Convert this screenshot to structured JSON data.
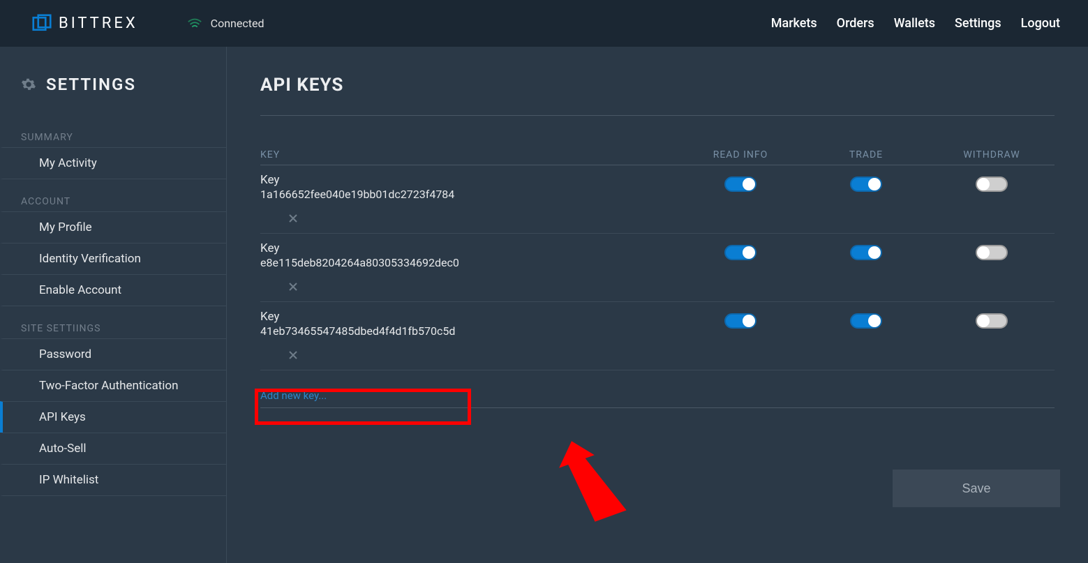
{
  "header": {
    "brand": "BITTREX",
    "connection": "Connected",
    "nav": [
      "Markets",
      "Orders",
      "Wallets",
      "Settings",
      "Logout"
    ]
  },
  "sidebar": {
    "title": "SETTINGS",
    "sections": {
      "summary": {
        "label": "SUMMARY",
        "items": [
          "My Activity"
        ]
      },
      "account": {
        "label": "ACCOUNT",
        "items": [
          "My Profile",
          "Identity Verification",
          "Enable Account"
        ]
      },
      "site": {
        "label": "SITE SETTIINGS",
        "items": [
          "Password",
          "Two-Factor Authentication",
          "API Keys",
          "Auto-Sell",
          "IP Whitelist"
        ]
      }
    },
    "active": "API Keys"
  },
  "page": {
    "title": "API KEYS",
    "columns": {
      "key": "KEY",
      "read": "READ INFO",
      "trade": "TRADE",
      "withdraw": "WITHDRAW"
    },
    "key_label": "Key",
    "keys": [
      {
        "id": "1a166652fee040e19bb01dc2723f4784",
        "read": true,
        "trade": true,
        "withdraw": false
      },
      {
        "id": "e8e115deb8204264a80305334692dec0",
        "read": true,
        "trade": true,
        "withdraw": false
      },
      {
        "id": "41eb73465547485dbed4f4d1fb570c5d",
        "read": true,
        "trade": true,
        "withdraw": false
      }
    ],
    "add_new": "Add new key...",
    "save": "Save"
  }
}
